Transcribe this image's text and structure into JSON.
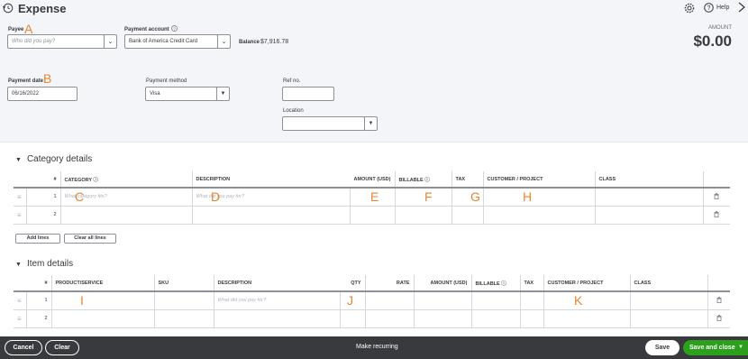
{
  "header": {
    "title": "Expense",
    "help_label": "Help",
    "amount_label": "AMOUNT",
    "amount_value": "$0.00"
  },
  "payee": {
    "label": "Payee",
    "placeholder": "Who did you pay?",
    "marker": "A"
  },
  "payment_account": {
    "label": "Payment account",
    "value": "Bank of America Credit Card",
    "balance_label": "Balance",
    "balance_value": "$7,916.78"
  },
  "payment_date": {
    "label": "Payment date",
    "value": "06/16/2022",
    "marker": "B"
  },
  "payment_method": {
    "label": "Payment method",
    "value": "Visa"
  },
  "ref_no": {
    "label": "Ref no.",
    "value": ""
  },
  "location": {
    "label": "Location",
    "value": ""
  },
  "category_details": {
    "title": "Category details",
    "columns": [
      "#",
      "CATEGORY",
      "DESCRIPTION",
      "AMOUNT (USD)",
      "BILLABLE",
      "TAX",
      "CUSTOMER / PROJECT",
      "CLASS"
    ],
    "rows": [
      {
        "num": "1",
        "category": "What category fits?",
        "description": "What did you pay for?"
      },
      {
        "num": "2",
        "category": "",
        "description": ""
      }
    ],
    "markers": {
      "category": "C",
      "description": "D",
      "amount": "E",
      "billable": "F",
      "tax": "G",
      "customer": "H"
    },
    "add_lines": "Add lines",
    "clear_lines": "Clear all lines"
  },
  "item_details": {
    "title": "Item details",
    "columns": [
      "#",
      "PRODUCT/SERVICE",
      "SKU",
      "DESCRIPTION",
      "QTY",
      "RATE",
      "AMOUNT (USD)",
      "BILLABLE",
      "TAX",
      "CUSTOMER / PROJECT",
      "CLASS"
    ],
    "rows": [
      {
        "num": "1",
        "description": "What did you pay for?"
      },
      {
        "num": "2",
        "description": ""
      }
    ],
    "markers": {
      "product": "I",
      "qty": "J",
      "customer": "K"
    }
  },
  "footer": {
    "cancel": "Cancel",
    "clear": "Clear",
    "make_recurring": "Make recurring",
    "save": "Save",
    "save_and_close": "Save and close"
  },
  "colors": {
    "accent_green": "#2ca01c",
    "footer_bg": "#393a3d",
    "marker_orange": "#e8862f"
  }
}
